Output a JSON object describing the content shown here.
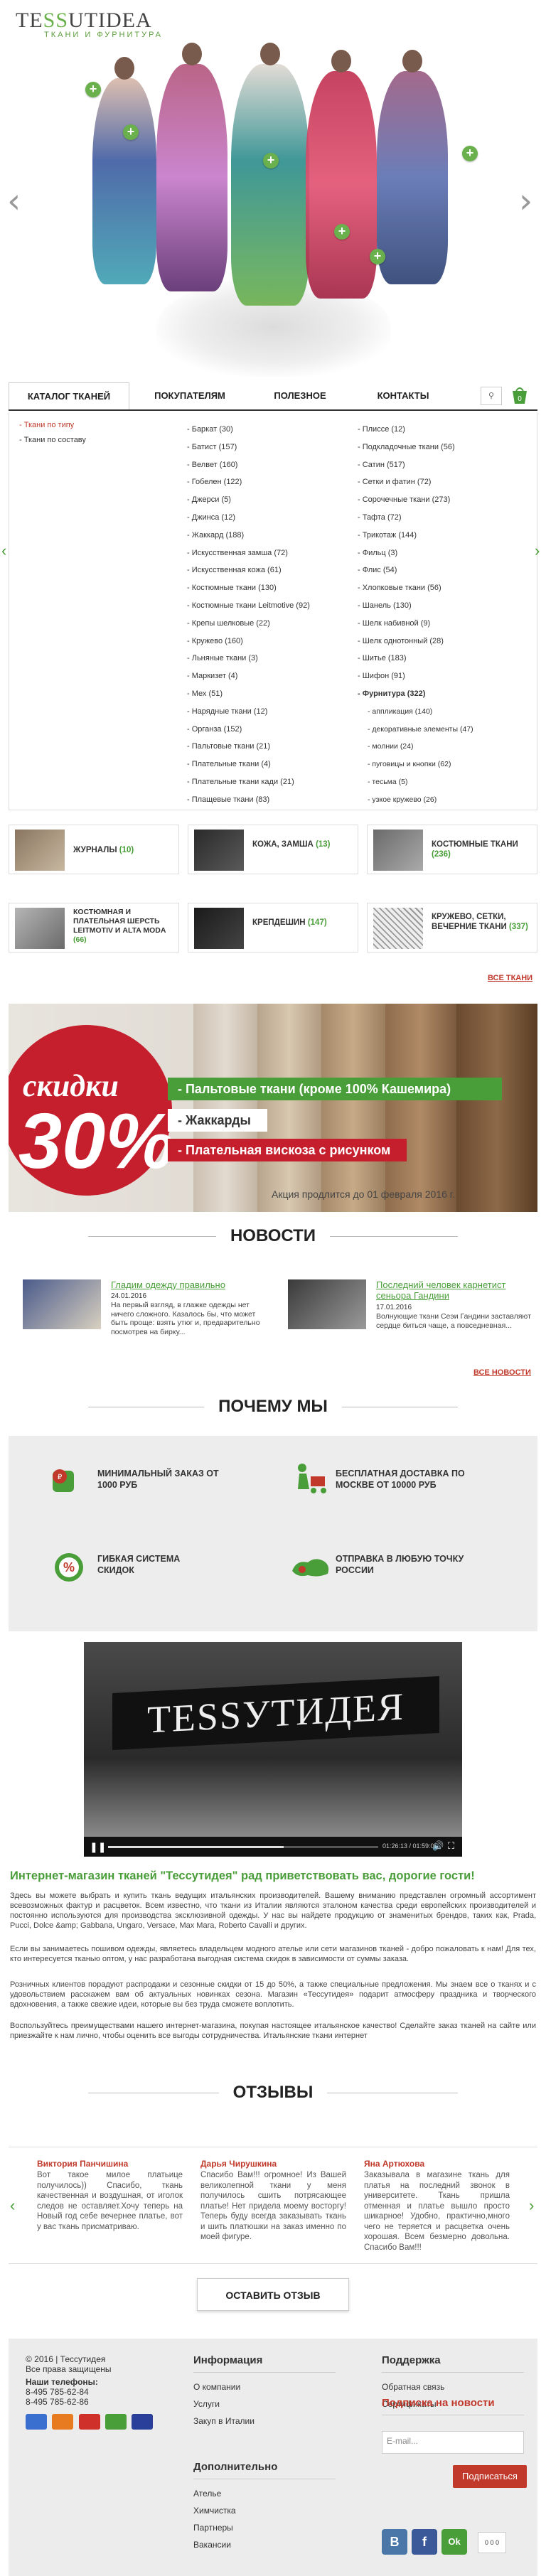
{
  "brand": {
    "name_a": "TE",
    "name_b": "SS",
    "name_c": "UTIDEA",
    "tagline": "ткани и фурнитура"
  },
  "nav": {
    "tabs": [
      "КАТАЛОГ ТКАНЕЙ",
      "ПОКУПАТЕЛЯМ",
      "ПОЛЕЗНОЕ",
      "КОНТАКТЫ"
    ],
    "cart_count": "0"
  },
  "catalog": {
    "filters": [
      "- Ткани по типу",
      "- Ткани по составу"
    ],
    "col1": [
      "- Баркат (30)",
      "- Батист (157)",
      "- Велвет (160)",
      "- Гобелен (122)",
      "- Джерси (5)",
      "- Джинса (12)",
      "- Жаккард (188)",
      "- Искусственная замша (72)",
      "- Искусственная кожа (61)",
      "- Костюмные ткани (130)",
      "- Костюмные ткани Leitmotive (92)",
      "- Крепы шелковые (22)",
      "- Кружево (160)",
      "- Льняные ткани (3)",
      "- Маркизет (4)",
      "- Мех (51)",
      "- Нарядные ткани (12)",
      "- Органза (152)",
      "- Пальтовые ткани (21)",
      "- Плательные ткани (4)",
      "- Плательные ткани кади (21)",
      "- Плащевые ткани (83)"
    ],
    "col2": [
      "- Плиссе (12)",
      "- Подкладочные ткани (56)",
      "- Сатин (517)",
      "- Сетки и фатин (72)",
      "- Сорочечные ткани (273)",
      "- Тафта (72)",
      "- Трикотаж (144)",
      "- Фильц (3)",
      "- Флис (54)",
      "- Хлопковые ткани (56)",
      "- Шанель (130)",
      "- Шелк набивной (9)",
      "- Шелк однотонный (28)",
      "- Шитье (183)",
      "- Шифон (91)"
    ],
    "col2_highlight": "- Фурнитура (322)",
    "col2_sub": [
      "- аппликация (140)",
      "- декоративные элементы (47)",
      "- молнии (24)",
      "- пуговицы и кнопки (62)",
      "- тесьма (5)",
      "- узкое кружево (26)"
    ]
  },
  "tiles": [
    {
      "label": "ЖУРНАЛЫ",
      "count": "(10)"
    },
    {
      "label": "КОЖА, ЗАМША",
      "count": "(13)"
    },
    {
      "label": "КОСТЮМНЫЕ ТКАНИ",
      "count": "(236)"
    },
    {
      "label": "КОСТЮМНАЯ И ПЛАТЕЛЬНАЯ ШЕРСТЬ LEITMOTIV И ALTA MODA",
      "count": "(66)"
    },
    {
      "label": "КРЕПДЕШИН",
      "count": "(147)"
    },
    {
      "label": "КРУЖЕВО, СЕТКИ, ВЕЧЕРНИЕ ТКАНИ",
      "count": "(337)"
    }
  ],
  "all_fabrics": "ВСЕ ТКАНИ",
  "banner": {
    "discount_word": "скидки",
    "discount_value": "30%",
    "lines": [
      "- Пальтовые ткани (кроме 100% Кашемира)",
      "- Жаккарды",
      "- Плательная вискоза с рисунком"
    ],
    "note": "Акция продлится до 01 февраля 2016 г."
  },
  "news": {
    "title": "НОВОСТИ",
    "items": [
      {
        "title": "Гладим одежду правильно",
        "date": "24.01.2016",
        "text": "На первый взгляд, в глажке одежды нет ничего сложного. Казалось бы, что может быть проще: взять утюг и, предварительно посмотрев на бирку..."
      },
      {
        "title": "Последний человек карнетист сеньора Гандини",
        "date": "17.01.2016",
        "text": "Волнующие ткани Сеэи Гандини заставляют сердце биться чаще, а повседневная..."
      }
    ],
    "all": "ВСЕ НОВОСТИ"
  },
  "why": {
    "title": "ПОЧЕМУ МЫ",
    "items": [
      "МИНИМАЛЬНЫЙ ЗАКАЗ ОТ 1000 РУБ",
      "БЕСПЛАТНАЯ ДОСТАВКА ПО МОСКВЕ ОТ 10000 РУБ",
      "ГИБКАЯ СИСТЕМА СКИДОК",
      "ОТПРАВКА В ЛЮБУЮ ТОЧКУ РОССИИ"
    ]
  },
  "video": {
    "sign": "TESSУТИДЕЯ",
    "time": "01:26:13 / 01:59:00"
  },
  "intro": {
    "title": "Интернет-магазин тканей \"Тессутидея\" рад приветствовать вас, дорогие гости!",
    "p1": "Здесь вы можете выбрать и купить ткань ведущих итальянских производителей. Вашему вниманию представлен огромный ассортимент всевозможных фактур и расцветок. Всем известно, что ткани из Италии являются эталоном качества среди европейских производителей и постоянно используются для производства эксклюзивной одежды. У нас вы найдете продукцию от знаменитых брендов, таких как, Prada, Pucci, Dolce &amp; Gabbana, Ungaro, Versace, Max Mara, Roberto Cavalli и других.",
    "p2": "Если вы занимаетесь пошивом одежды, являетесь владельцем модного ателье или сети магазинов тканей - добро пожаловать к нам! Для тех, кто интересуется тканью оптом, у нас разработана выгодная система скидок в зависимости от суммы заказа.",
    "p3": "Розничных клиентов порадуют распродажи и сезонные скидки от 15 до 50%, а также специальные предложения. Мы знаем все о тканях и с удовольствием расскажем вам об актуальных новинках сезона. Магазин «Тессутидея» подарит атмосферу праздника и творческого вдохновения, а также свежие идеи, которые вы без труда сможете воплотить.",
    "p4": "Воспользуйтесь преимуществами нашего интернет-магазина, покупая настоящее итальянское качество! Сделайте заказ тканей на сайте или приезжайте к нам лично, чтобы оценить все выгоды сотрудничества. Итальянские ткани интернет"
  },
  "reviews": {
    "title": "ОТЗЫВЫ",
    "items": [
      {
        "name": "Виктория Панчишина",
        "text": "Вот такое милое платьице получилось)) Спасибо, ткань качественная и воздушная, от иголок следов не оставляет.Хочу теперь на Новый год себе вечернее платье, вот у вас ткань присматриваю."
      },
      {
        "name": "Дарья Чирушкина",
        "text": "Спасибо Вам!!! огромное! Из Вашей великолепной ткани у меня получилось сшить потрясающее платье! Нет придела моему восторгу! Теперь буду всегда заказывать ткань и шить платюшки на заказ именно по моей фигуре."
      },
      {
        "name": "Яна Артюхова",
        "text": "Заказывала в магазине ткань для платья на последний звонок в университете. Ткань пришла отменная и платье вышло просто шикарное! Удобно, практично,много чего не теряется и расцветка очень хорошая. Всем безмерно довольна. Спасибо Вам!!!"
      }
    ],
    "button": "ОСТАВИТЬ ОТЗЫВ"
  },
  "footer": {
    "copyright": "© 2016 | Тессутидея",
    "rights": "Все права защищены",
    "phones_label": "Наши телефоны:",
    "phones": [
      "8-495 785-62-84",
      "8-495 785-62-86"
    ],
    "info_title": "Информация",
    "info_links": [
      "О компании",
      "Услуги",
      "Закуп в Италии"
    ],
    "support_title": "Поддержка",
    "support_links": [
      "Обратная связь",
      "Сертификаты"
    ],
    "extra_title": "Дополнительно",
    "extra_links": [
      "Ателье",
      "Химчистка",
      "Партнеры",
      "Вакансии"
    ],
    "subscribe_title": "Подписка на новости",
    "email_placeholder": "E-mail...",
    "subscribe_button": "Подписаться",
    "socials": [
      "В",
      "f",
      "Ok"
    ],
    "counter": "0 0 0"
  },
  "colors": {
    "accent": "#4a9e3a",
    "red": "#c0392b",
    "banner_red": "#c51f2e"
  }
}
